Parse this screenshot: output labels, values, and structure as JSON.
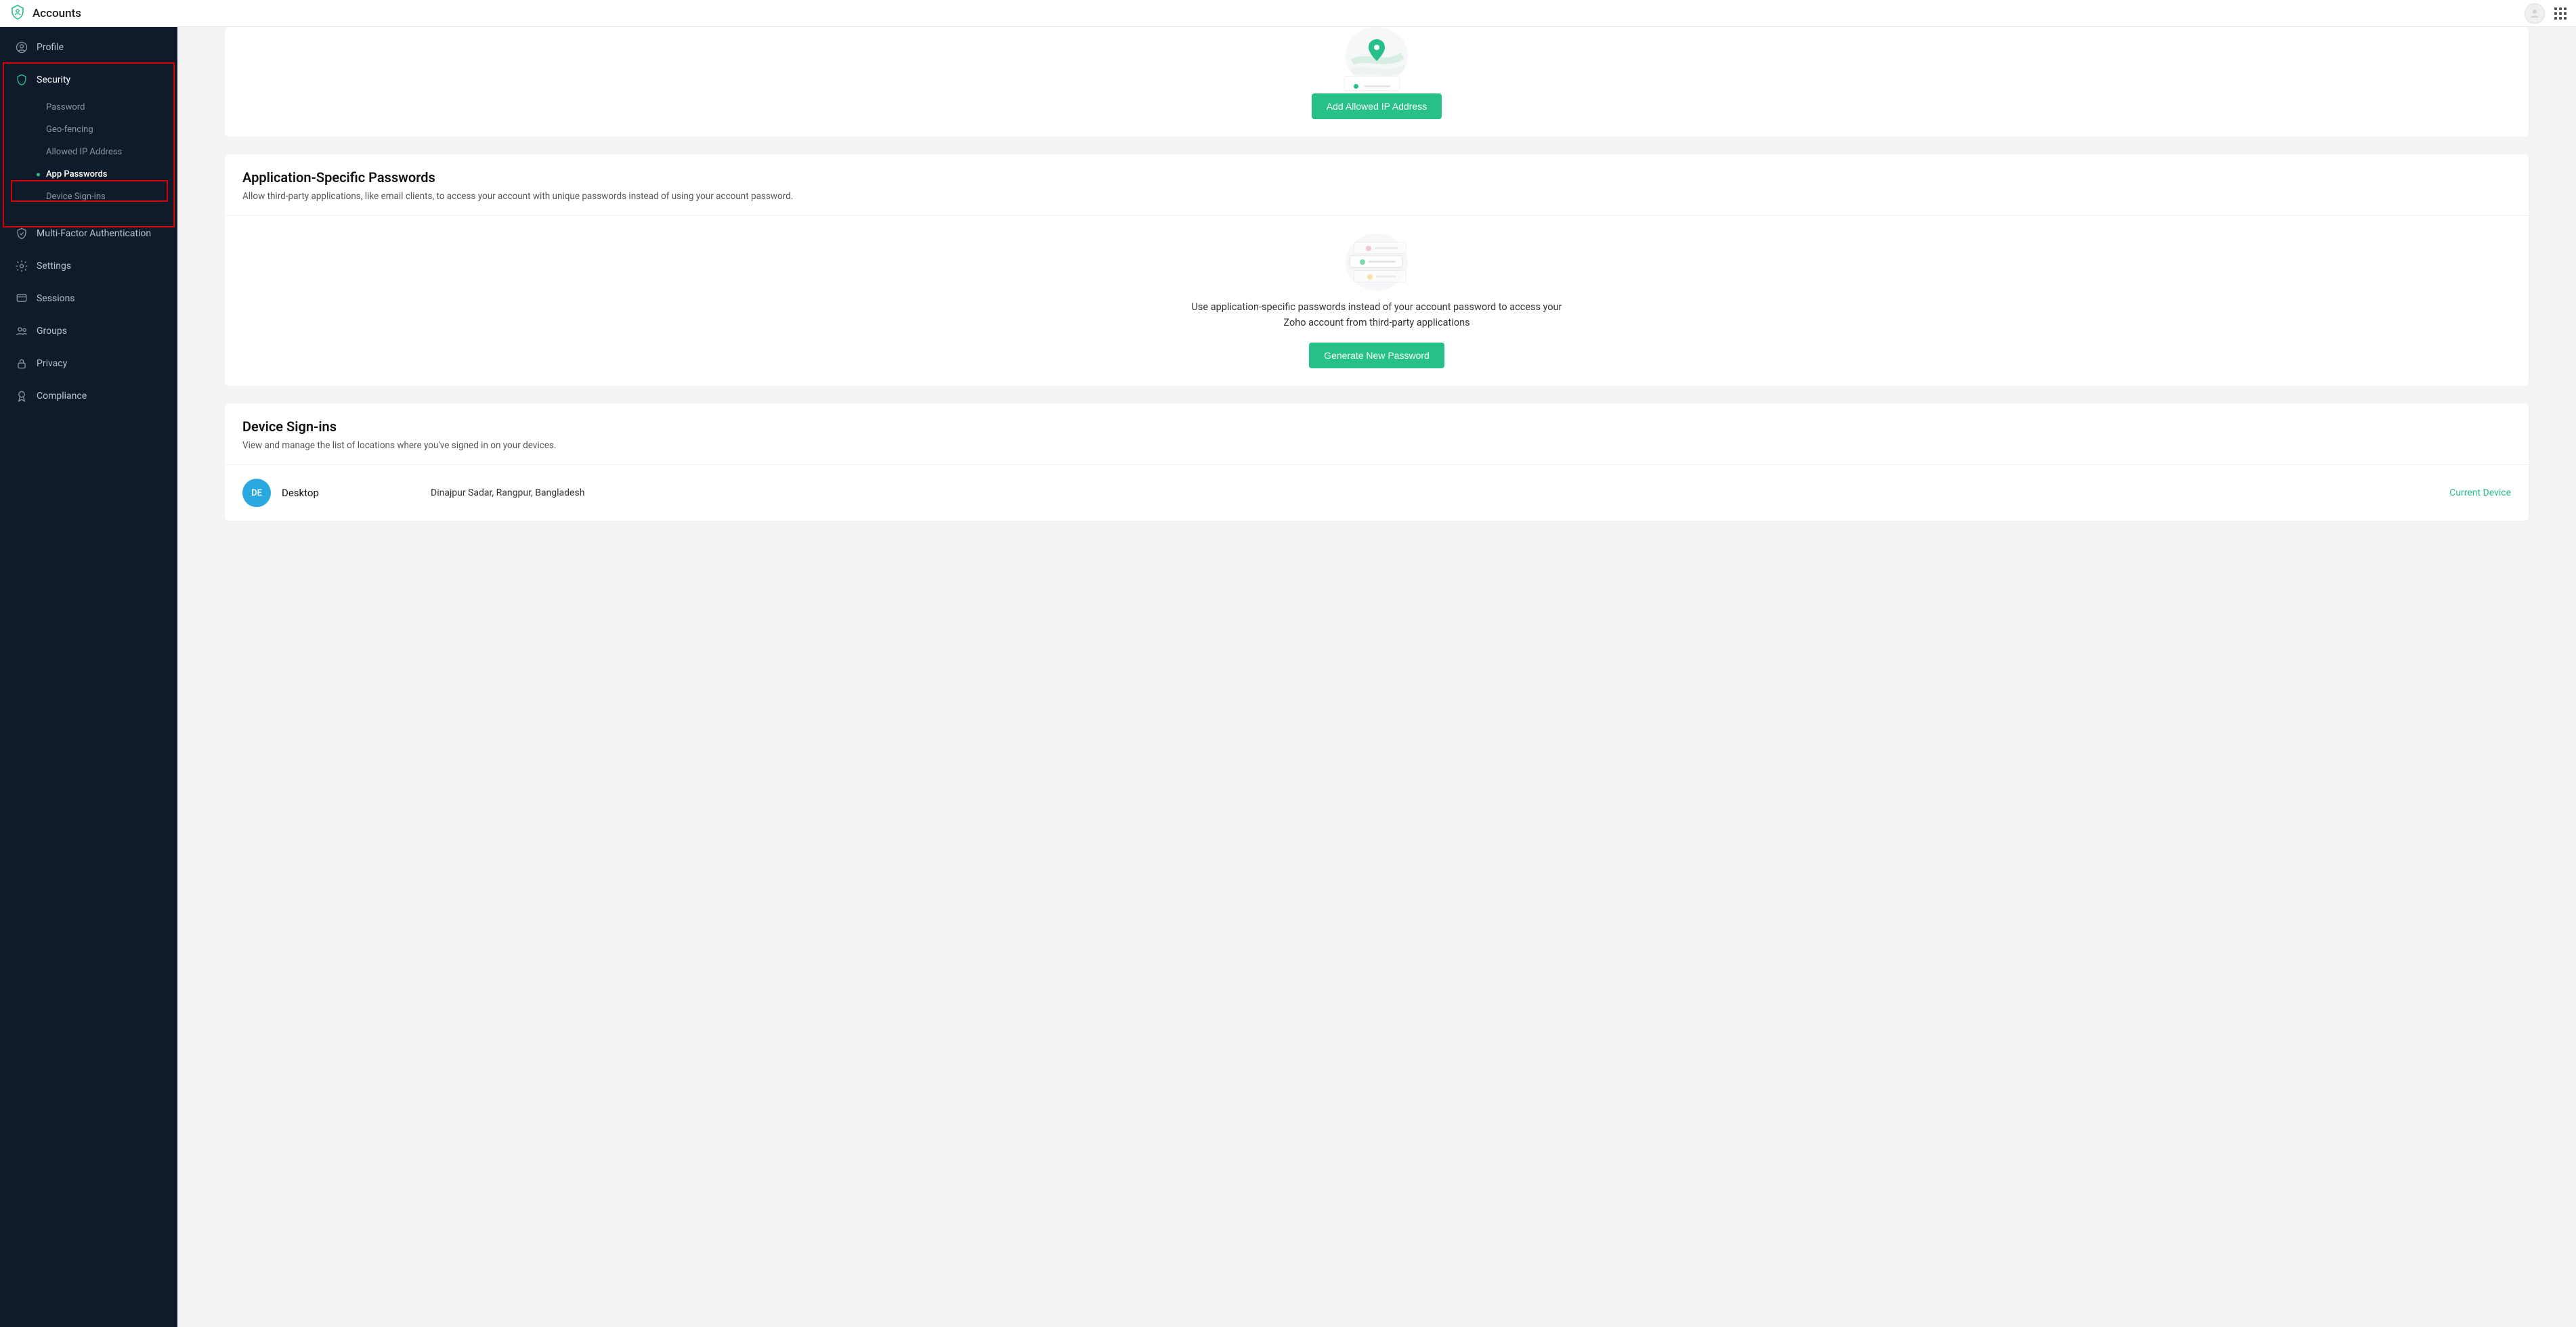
{
  "brand": {
    "title": "Accounts"
  },
  "sidebar": {
    "profile": "Profile",
    "security": "Security",
    "security_sub": {
      "password": "Password",
      "geofencing": "Geo-fencing",
      "allowed_ip": "Allowed IP Address",
      "app_passwords": "App Passwords",
      "device_signins": "Device Sign-ins"
    },
    "mfa": "Multi-Factor Authentication",
    "settings": "Settings",
    "sessions": "Sessions",
    "groups": "Groups",
    "privacy": "Privacy",
    "compliance": "Compliance"
  },
  "allowed_ip": {
    "button": "Add Allowed IP Address"
  },
  "app_passwords": {
    "title": "Application-Specific Passwords",
    "subtitle": "Allow third-party applications, like email clients, to access your account with unique passwords instead of using your account password.",
    "description": "Use application-specific passwords instead of your account password to access your Zoho account from third-party applications",
    "button": "Generate New Password"
  },
  "device_signins": {
    "title": "Device Sign-ins",
    "subtitle": "View and manage the list of locations where you've signed in on your devices.",
    "rows": [
      {
        "badge": "DE",
        "name": "Desktop",
        "location": "Dinajpur Sadar, Rangpur, Bangladesh",
        "tag": "Current Device"
      }
    ]
  }
}
